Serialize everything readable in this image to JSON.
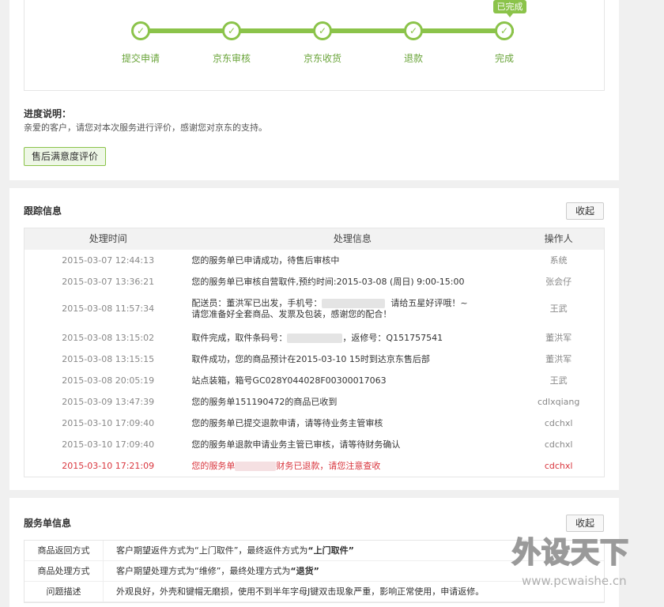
{
  "progress": {
    "done_badge": "已完成",
    "steps": [
      {
        "label": "提交申请"
      },
      {
        "label": "京东审核"
      },
      {
        "label": "京东收货"
      },
      {
        "label": "退款"
      },
      {
        "label": "完成"
      }
    ],
    "note_title": "进度说明：",
    "note_text": "亲爱的客户，请您对本次服务进行评价，感谢您对京东的支持。",
    "eval_button": "售后满意度评价",
    "accent_color": "#8bc34a"
  },
  "tracking": {
    "title": "跟踪信息",
    "collapse_button": "收起",
    "columns": {
      "time": "处理时间",
      "message": "处理信息",
      "operator": "操作人"
    },
    "rows": [
      {
        "time": "2015-03-07 12:44:13",
        "message": "您的服务单已申请成功，待售后审核中",
        "operator": "系统"
      },
      {
        "time": "2015-03-07 13:36:21",
        "message": "您的服务单已审核自营取件,预约时间:2015-03-08 (周日) 9:00-15:00",
        "operator": "张会仔"
      },
      {
        "time": "2015-03-08 11:57:34",
        "message_a": "配送员：董洪军已出发，手机号：",
        "message_b": "请给五星好评哦！~",
        "message_line2": "请您准备好全套商品、发票及包装，感谢您的配合！",
        "operator": "王武"
      },
      {
        "time": "2015-03-08 13:15:02",
        "message_a": "取件完成，取件条码号：",
        "message_b": "，返修号：Q151757541",
        "operator": "董洪军"
      },
      {
        "time": "2015-03-08 13:15:15",
        "message": "取件成功，您的商品预计在2015-03-10 15时到达京东售后部",
        "operator": "董洪军"
      },
      {
        "time": "2015-03-08 20:05:19",
        "message": "站点装箱，箱号GC028Y044028F00300017063",
        "operator": "王武"
      },
      {
        "time": "2015-03-09 13:47:39",
        "message": "您的服务单151190472的商品已收到",
        "operator": "cdlxqiang"
      },
      {
        "time": "2015-03-10 17:09:40",
        "message": "您的服务单已提交退款申请，请等待业务主管审核",
        "operator": "cdchxl"
      },
      {
        "time": "2015-03-10 17:09:40",
        "message": "您的服务单退款申请业务主管已审核，请等待财务确认",
        "operator": "cdchxl"
      },
      {
        "time": "2015-03-10 17:21:09",
        "message_a": "您的服务单",
        "message_b": "财务已退款，请您注意查收",
        "operator": "cdchxl"
      }
    ],
    "highlight_color": "#d9363e"
  },
  "service": {
    "title": "服务单信息",
    "collapse_button": "收起",
    "rows": [
      {
        "key": "商品返回方式",
        "pre": "客户期望返件方式为“上门取件”，最终返件方式为",
        "bold": "“上门取件”"
      },
      {
        "key": "商品处理方式",
        "pre": "客户期望处理方式为“维修”，最终处理方式为",
        "bold": "“退货”"
      },
      {
        "key": "问题描述",
        "pre": "外观良好，外壳和键帽无磨损，使用不到半年字母J键双击现象严重，影响正常使用，申请返修。",
        "bold": ""
      }
    ]
  },
  "watermark": {
    "big": "外设天下",
    "url": "www.pcwaishe.cn"
  }
}
